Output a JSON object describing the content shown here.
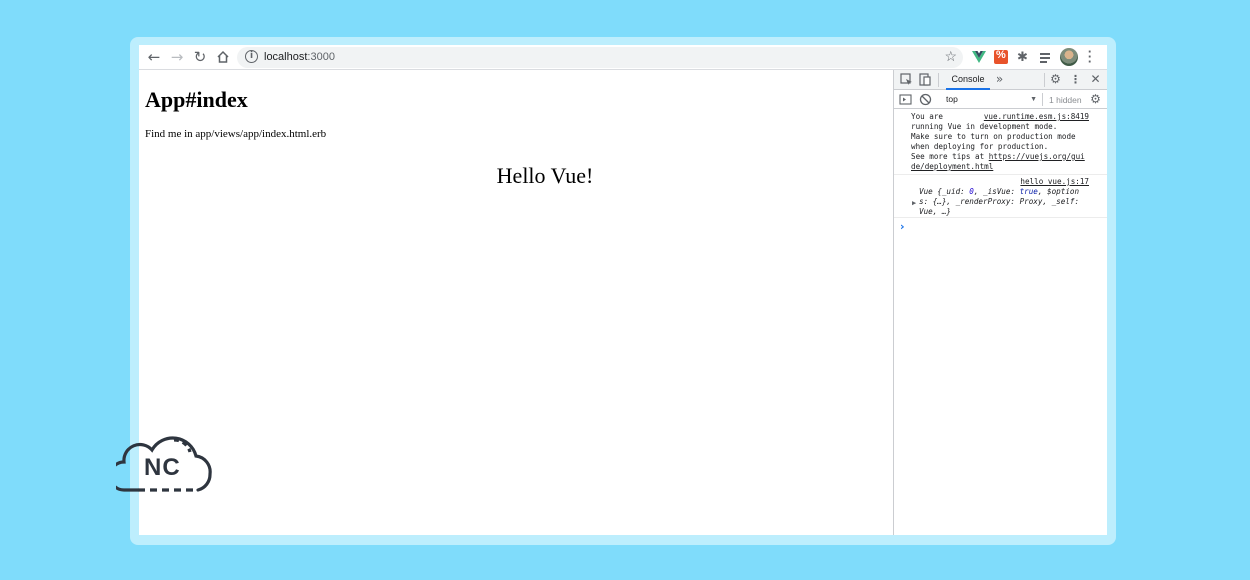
{
  "browser": {
    "url_host": "localhost",
    "url_port": ":3000",
    "icons": [
      "back-icon",
      "forward-icon",
      "reload-icon",
      "home-icon",
      "info-icon",
      "star-icon",
      "vue-devtools-icon",
      "extension-icon",
      "puzzle-icon",
      "reading-list-icon",
      "avatar",
      "menu-icon"
    ]
  },
  "page": {
    "heading": "App#index",
    "hint": "Find me in app/views/app/index.html.erb",
    "message": "Hello Vue!"
  },
  "devtools": {
    "tab_label": "Console",
    "context": "top",
    "hidden_count": "1 hidden",
    "logs": [
      {
        "source": "vue.runtime.esm.js:8419",
        "lines": [
          "You are",
          "running Vue in development mode.",
          "Make sure to turn on production mode",
          "when deploying for production.",
          "See more tips at "
        ],
        "link1": "https://vuejs.org/gui",
        "link2": "de/deployment.html"
      },
      {
        "source": "hello_vue.js:17",
        "obj_line1_a": "Vue {_uid: ",
        "obj_line1_b": "0",
        "obj_line1_c": ", _isVue: ",
        "obj_line1_d": "true",
        "obj_line1_e": ", $option",
        "obj_line2": "s: {…}, _renderProxy: Proxy, _self:",
        "obj_line3": "Vue, …}"
      }
    ]
  },
  "colors": {
    "background": "#7fdcfb",
    "frame": "#bdeefd",
    "vue_green": "#41b883",
    "accent_blue": "#1a73e8"
  },
  "logo": {
    "text": "NC"
  }
}
